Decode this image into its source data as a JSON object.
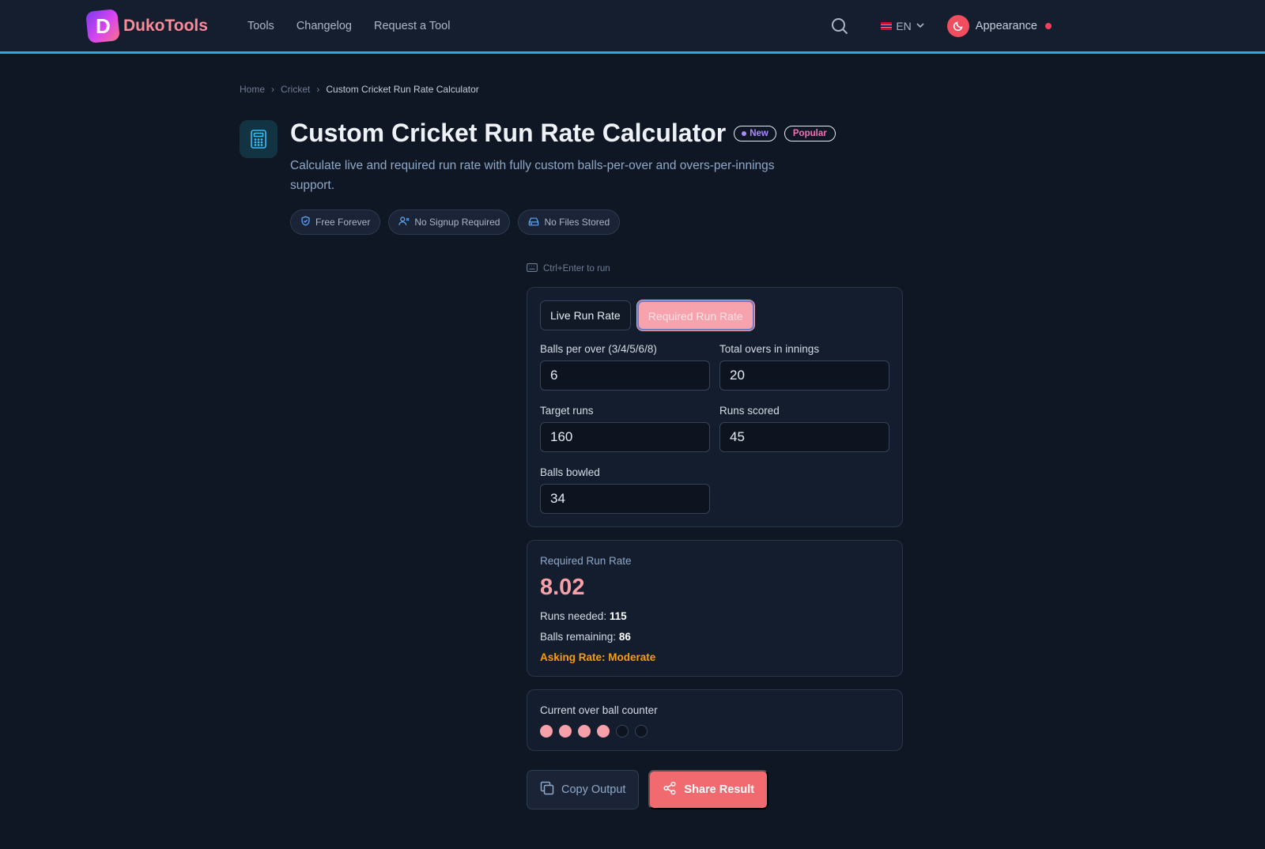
{
  "nav": {
    "logo_letter": "D",
    "brand": "DukoTools",
    "links": [
      "Tools",
      "Changelog",
      "Request a Tool"
    ],
    "language": "EN",
    "appearance": "Appearance"
  },
  "breadcrumb": [
    "Home",
    "Cricket",
    "Custom Cricket Run Rate Calculator"
  ],
  "page": {
    "title": "Custom Cricket Run Rate Calculator",
    "badge_new": "New",
    "badge_popular": "Popular",
    "subtitle": "Calculate live and required run rate with fully custom balls-per-over and overs-per-innings support.",
    "chips": [
      "Free Forever",
      "No Signup Required",
      "No Files Stored"
    ]
  },
  "tool": {
    "hint": "Ctrl+Enter to run",
    "tabs": [
      "Live Run Rate",
      "Required Run Rate"
    ],
    "active_tab": "Required Run Rate",
    "fields": {
      "balls_per_over": {
        "label": "Balls per over (3/4/5/6/8)",
        "value": "6"
      },
      "total_overs": {
        "label": "Total overs in innings",
        "value": "20"
      },
      "target_runs": {
        "label": "Target runs",
        "value": "160"
      },
      "runs_scored": {
        "label": "Runs scored",
        "value": "45"
      },
      "balls_bowled": {
        "label": "Balls bowled",
        "value": "34"
      }
    },
    "result": {
      "label": "Required Run Rate",
      "value": "8.02",
      "runs_needed_label": "Runs needed:",
      "runs_needed": "115",
      "balls_remaining_label": "Balls remaining:",
      "balls_remaining": "86",
      "asking_rate": "Asking Rate: Moderate"
    },
    "ball_counter": {
      "label": "Current over ball counter",
      "balls_bowled_in_over": 4,
      "balls_per_over": 6
    },
    "actions": {
      "copy": "Copy Output",
      "share": "Share Result"
    }
  },
  "colors": {
    "accent": "#f7a0aa",
    "share": "#f16a6f",
    "warning": "#f59e0b",
    "nav_border": "#2aa8e0"
  }
}
